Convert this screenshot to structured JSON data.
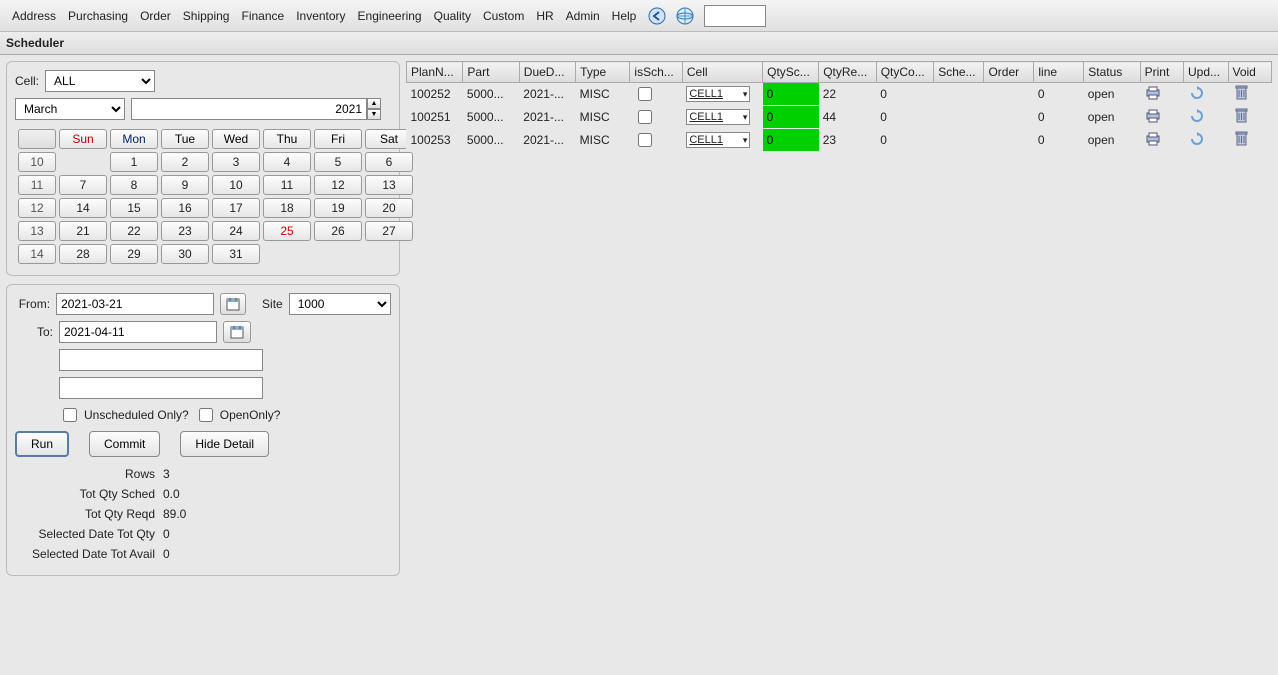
{
  "menu": {
    "items": [
      "Address",
      "Purchasing",
      "Order",
      "Shipping",
      "Finance",
      "Inventory",
      "Engineering",
      "Quality",
      "Custom",
      "HR",
      "Admin",
      "Help"
    ],
    "search_value": ""
  },
  "title": "Scheduler",
  "cell_filter": {
    "label": "Cell:",
    "value": "ALL"
  },
  "calendar": {
    "month": "March",
    "year": "2021",
    "day_headers": [
      "Sun",
      "Mon",
      "Tue",
      "Wed",
      "Thu",
      "Fri",
      "Sat"
    ],
    "week_numbers": [
      "10",
      "11",
      "12",
      "13",
      "14"
    ],
    "rows": [
      [
        "",
        "1",
        "2",
        "3",
        "4",
        "5",
        "6"
      ],
      [
        "7",
        "8",
        "9",
        "10",
        "11",
        "12",
        "13"
      ],
      [
        "14",
        "15",
        "16",
        "17",
        "18",
        "19",
        "20"
      ],
      [
        "21",
        "22",
        "23",
        "24",
        "25",
        "26",
        "27"
      ],
      [
        "28",
        "29",
        "30",
        "31",
        "",
        "",
        ""
      ]
    ],
    "today": "25"
  },
  "filters": {
    "from_label": "From:",
    "from_value": "2021-03-21",
    "to_label": "To:",
    "to_value": "2021-04-11",
    "site_label": "Site",
    "site_value": "1000",
    "extra1": "",
    "extra2": "",
    "unscheduled_label": "Unscheduled Only?",
    "unscheduled_checked": false,
    "openonly_label": "OpenOnly?",
    "openonly_checked": false
  },
  "buttons": {
    "run": "Run",
    "commit": "Commit",
    "hide_detail": "Hide Detail"
  },
  "summary": {
    "rows_label": "Rows",
    "rows_value": "3",
    "tot_sched_label": "Tot Qty Sched",
    "tot_sched_value": "0.0",
    "tot_reqd_label": "Tot Qty Reqd",
    "tot_reqd_value": "89.0",
    "sel_tot_qty_label": "Selected Date Tot Qty",
    "sel_tot_qty_value": "0",
    "sel_tot_avail_label": "Selected Date Tot Avail",
    "sel_tot_avail_value": "0"
  },
  "table": {
    "headers": [
      "PlanN...",
      "Part",
      "DueD...",
      "Type",
      "isSch...",
      "Cell",
      "QtySc...",
      "QtyRe...",
      "QtyCo...",
      "Sche...",
      "Order",
      "line",
      "Status",
      "Print",
      "Upd...",
      "Void"
    ],
    "rows": [
      {
        "plan": "100252",
        "part": "5000...",
        "due": "2021-...",
        "type": "MISC",
        "sched": false,
        "cell": "CELL1",
        "qtysc": "0",
        "qtyre": "22",
        "qtyco": "0",
        "sche": "",
        "order": "",
        "line": "0",
        "status": "open"
      },
      {
        "plan": "100251",
        "part": "5000...",
        "due": "2021-...",
        "type": "MISC",
        "sched": false,
        "cell": "CELL1",
        "qtysc": "0",
        "qtyre": "44",
        "qtyco": "0",
        "sche": "",
        "order": "",
        "line": "0",
        "status": "open"
      },
      {
        "plan": "100253",
        "part": "5000...",
        "due": "2021-...",
        "type": "MISC",
        "sched": false,
        "cell": "CELL1",
        "qtysc": "0",
        "qtyre": "23",
        "qtyco": "0",
        "sche": "",
        "order": "",
        "line": "0",
        "status": "open"
      }
    ]
  },
  "icons": {
    "back": "back-icon",
    "globe": "globe-icon",
    "print": "printer-icon",
    "update": "refresh-icon",
    "void": "trash-icon",
    "calendar": "calendar-icon"
  }
}
